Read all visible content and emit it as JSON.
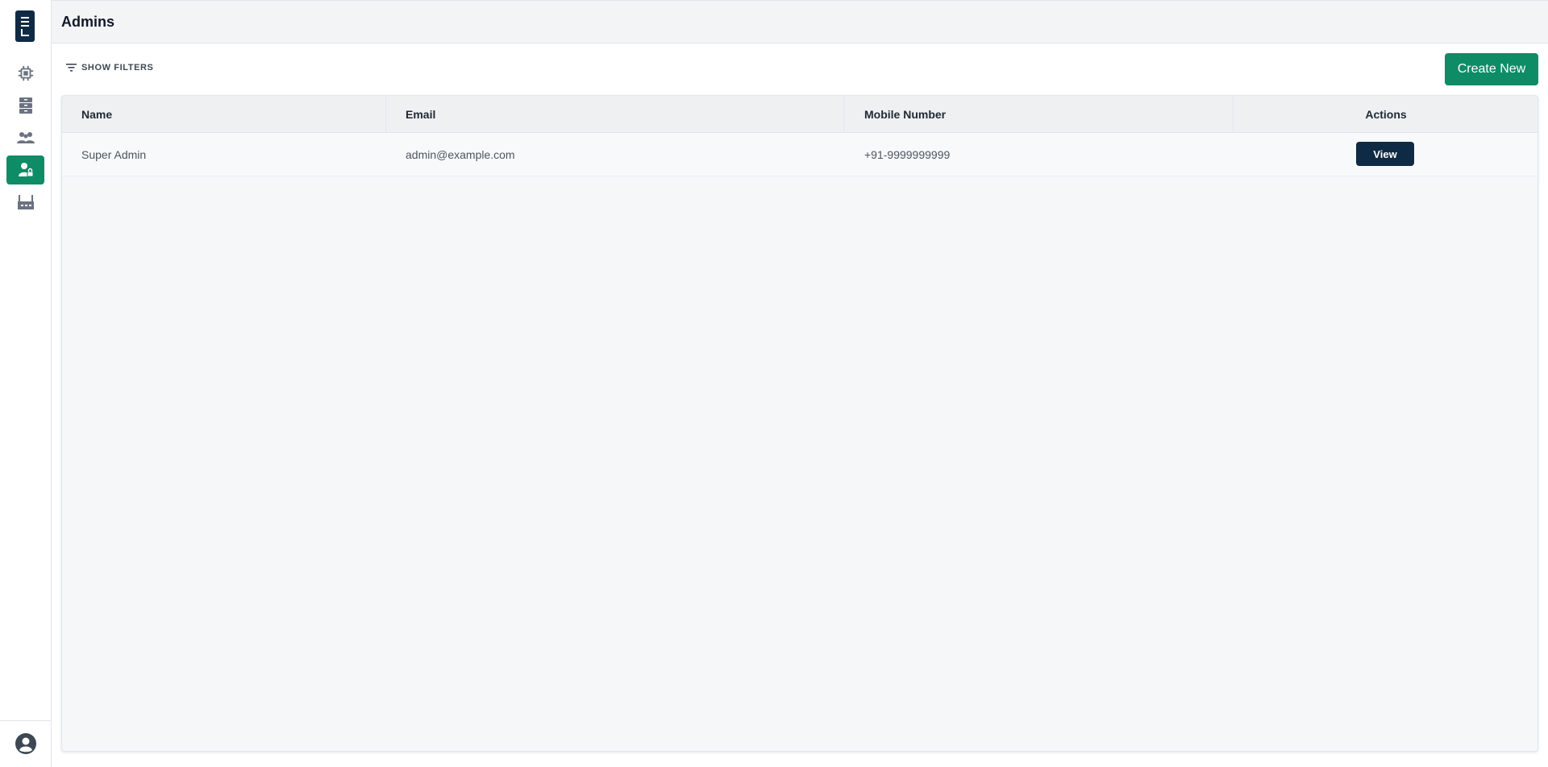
{
  "app": {
    "brand_colors": {
      "primary": "#0e8c65",
      "dark": "#0f2a44"
    }
  },
  "sidebar": {
    "items": [
      {
        "icon": "chip-icon",
        "active": false
      },
      {
        "icon": "server-icon",
        "active": false
      },
      {
        "icon": "users-icon",
        "active": false
      },
      {
        "icon": "admin-user-icon",
        "active": true
      },
      {
        "icon": "factory-icon",
        "active": false
      }
    ],
    "bottom_icon": "account-circle-icon"
  },
  "header": {
    "title": "Admins"
  },
  "toolbar": {
    "filters_label": "SHOW FILTERS",
    "create_label": "Create New"
  },
  "table": {
    "columns": [
      "Name",
      "Email",
      "Mobile Number",
      "Actions"
    ],
    "rows": [
      {
        "name": "Super Admin",
        "email": "admin@example.com",
        "mobile": "+91-9999999999",
        "action_label": "View"
      }
    ]
  }
}
